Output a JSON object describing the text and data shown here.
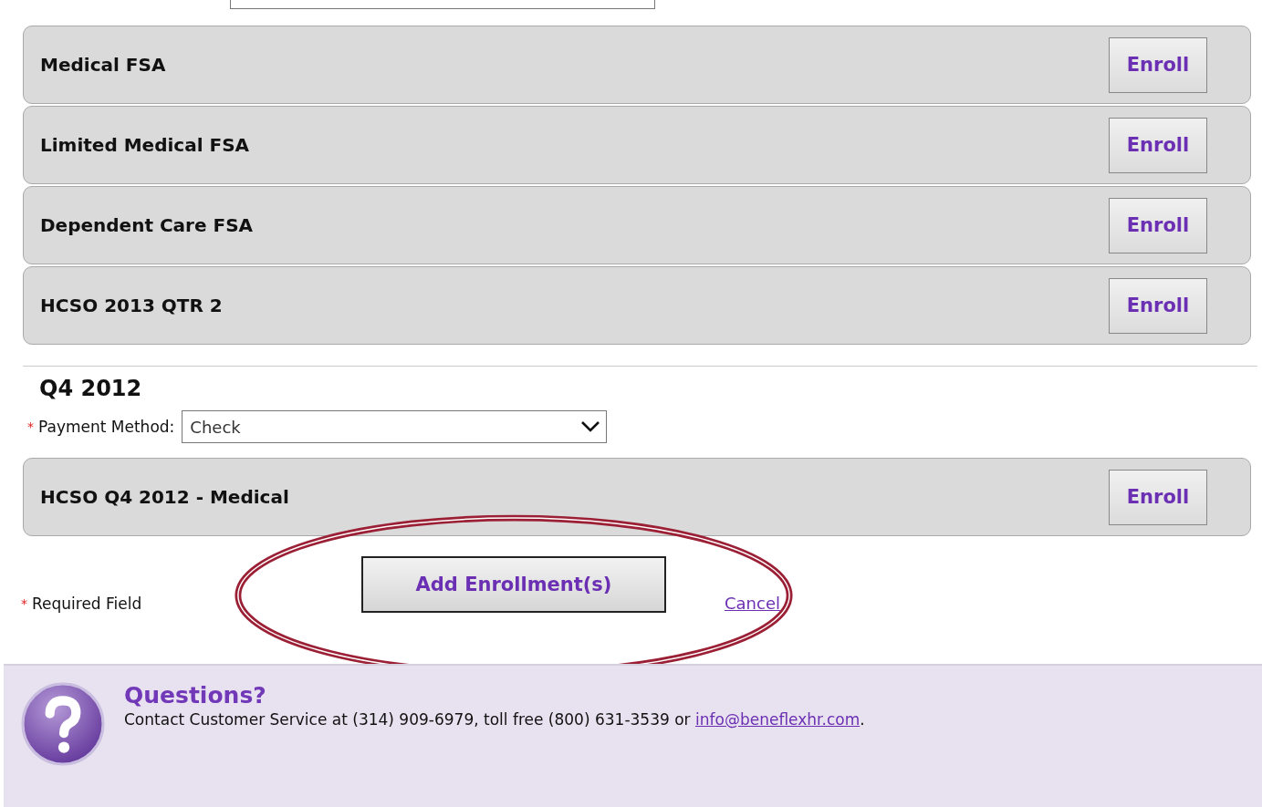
{
  "plan_groups": [
    {
      "plans": [
        {
          "name": "Medical FSA",
          "action": "Enroll"
        },
        {
          "name": "Limited Medical FSA",
          "action": "Enroll"
        },
        {
          "name": "Dependent Care FSA",
          "action": "Enroll"
        },
        {
          "name": "HCSO 2013 QTR 2",
          "action": "Enroll"
        }
      ]
    },
    {
      "heading": "Q4 2012",
      "payment": {
        "required_mark": "*",
        "label": "Payment Method:",
        "value": "Check"
      },
      "plans": [
        {
          "name": "HCSO Q4 2012 - Medical",
          "action": "Enroll"
        }
      ]
    }
  ],
  "required_note": {
    "mark": "*",
    "text": "Required Field"
  },
  "submit_button": "Add Enrollment(s)",
  "cancel_link": "Cancel",
  "help": {
    "title": "Questions?",
    "text_before": "Contact Customer Service at (314) 909-6979, toll free (800) 631-3539 or ",
    "email": "info@beneflexhr.com",
    "text_after": "."
  }
}
